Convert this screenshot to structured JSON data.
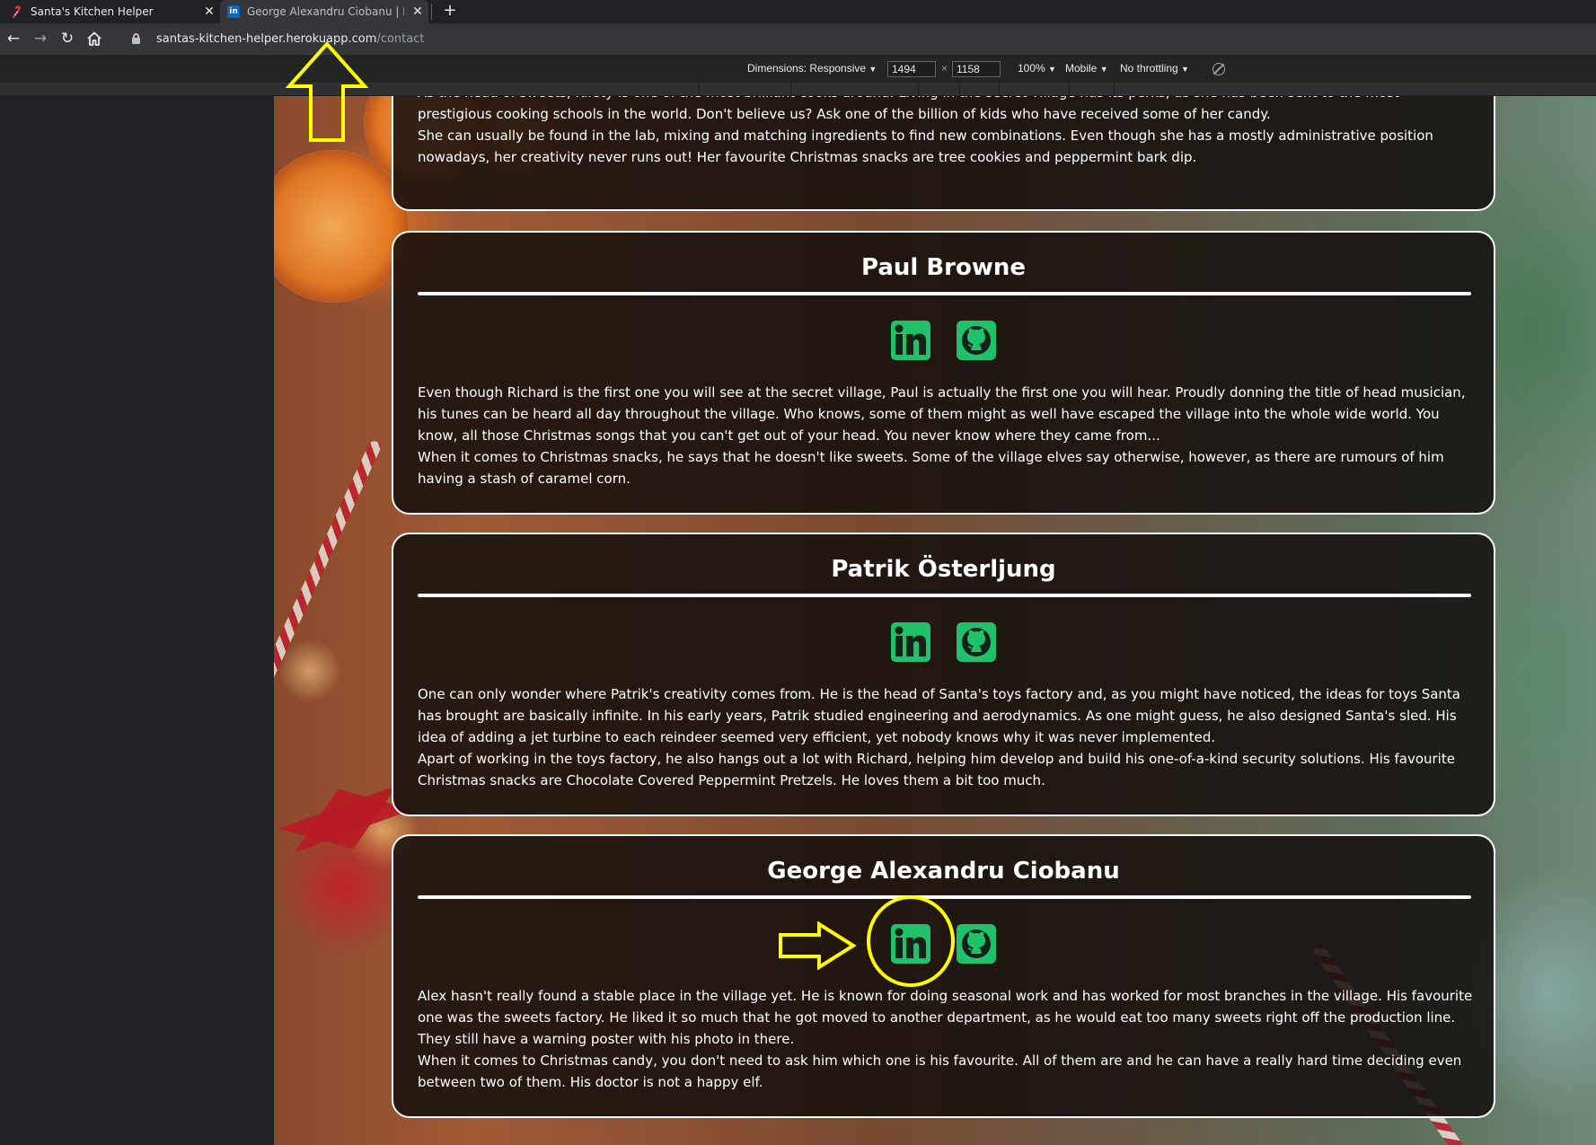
{
  "browser": {
    "tabs": [
      {
        "title": "Santa's Kitchen Helper",
        "active": false
      },
      {
        "title": "George Alexandru Ciobanu | Link",
        "active": true
      }
    ],
    "url_host": "santas-kitchen-helper.herokuapp.com",
    "url_path": "/contact"
  },
  "devtools": {
    "dimensions_label": "Dimensions: Responsive",
    "width_value": "1494",
    "height_value": "1158",
    "times": "×",
    "zoom": "100%",
    "device": "Mobile",
    "throttling": "No throttling",
    "dropdown_arrow": "▼"
  },
  "cards": [
    {
      "name": "",
      "paragraphs": [
        "As the head of sweets, Kirsty is one of the most brilliant cooks around. Living in the secret village has its perks, as she has been sent to the most prestigious cooking schools in the world. Don't believe us? Ask one of the billion of kids who have received some of her candy.",
        "She can usually be found in the lab, mixing and matching ingredients to find new combinations. Even though she has a mostly administrative position nowadays, her creativity never runs out! Her favourite Christmas snacks are tree cookies and peppermint bark dip."
      ]
    },
    {
      "name": "Paul Browne",
      "paragraphs": [
        "Even though Richard is the first one you will see at the secret village, Paul is actually the first one you will hear. Proudly donning the title of head musician, his tunes can be heard all day throughout the village. Who knows, some of them might as well have escaped the village into the whole wide world. You know, all those Christmas songs that you can't get out of your head. You never know where they came from...",
        "When it comes to Christmas snacks, he says that he doesn't like sweets. Some of the village elves say otherwise, however, as there are rumours of him having a stash of caramel corn."
      ]
    },
    {
      "name": "Patrik Österljung",
      "paragraphs": [
        "One can only wonder where Patrik's creativity comes from. He is the head of Santa's toys factory and, as you might have noticed, the ideas for toys Santa has brought are basically infinite. In his early years, Patrik studied engineering and aerodynamics. As one might guess, he also designed Santa's sled. His idea of adding a jet turbine to each reindeer seemed very efficient, yet nobody knows why it was never implemented.",
        "Apart of working in the toys factory, he also hangs out a lot with Richard, helping him develop and build his one-of-a-kind security solutions. His favourite Christmas snacks are Chocolate Covered Peppermint Pretzels. He loves them a bit too much."
      ]
    },
    {
      "name": "George Alexandru Ciobanu",
      "paragraphs": [
        "Alex hasn't really found a stable place in the village yet. He is known for doing seasonal work and has worked for most branches in the village. His favourite one was the sweets factory. He liked it so much that he got moved to another department, as he would eat too many sweets right off the production line. They still have a warning poster with his photo in there.",
        "When it comes to Christmas candy, you don't need to ask him which one is his favourite. All of them are and he can have a really hard time deciding even between two of them. His doctor is not a happy elf."
      ]
    }
  ],
  "colors": {
    "icon_green": "#1fc26a",
    "icon_dark": "#14231a",
    "annotation_yellow": "#ffff00",
    "card_border": "#ffffff"
  },
  "icons": [
    "linkedin-icon",
    "github-icon"
  ]
}
